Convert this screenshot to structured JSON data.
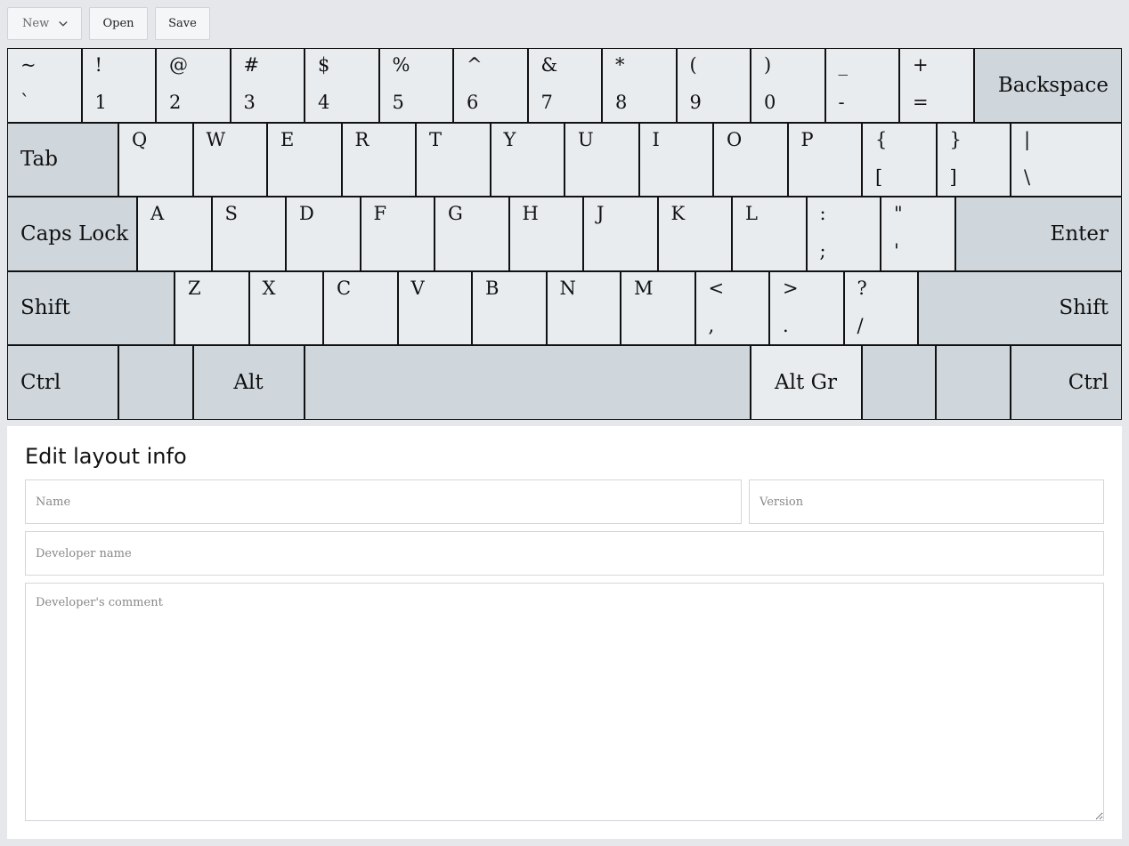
{
  "toolbar": {
    "new_label": "New",
    "open_label": "Open",
    "save_label": "Save"
  },
  "keyboard": {
    "row1": [
      {
        "up": "~",
        "down": "`"
      },
      {
        "up": "!",
        "down": "1"
      },
      {
        "up": "@",
        "down": "2"
      },
      {
        "up": "#",
        "down": "3"
      },
      {
        "up": "$",
        "down": "4"
      },
      {
        "up": "%",
        "down": "5"
      },
      {
        "up": "^",
        "down": "6"
      },
      {
        "up": "&",
        "down": "7"
      },
      {
        "up": "*",
        "down": "8"
      },
      {
        "up": "(",
        "down": "9"
      },
      {
        "up": ")",
        "down": "0"
      },
      {
        "up": "_",
        "down": "-"
      },
      {
        "up": "+",
        "down": "="
      }
    ],
    "backspace": "Backspace",
    "tab": "Tab",
    "row2": [
      {
        "up": "Q"
      },
      {
        "up": "W"
      },
      {
        "up": "E"
      },
      {
        "up": "R"
      },
      {
        "up": "T"
      },
      {
        "up": "Y"
      },
      {
        "up": "U"
      },
      {
        "up": "I"
      },
      {
        "up": "O"
      },
      {
        "up": "P"
      },
      {
        "up": "{",
        "down": "["
      },
      {
        "up": "}",
        "down": "]"
      },
      {
        "up": "|",
        "down": "\\"
      }
    ],
    "caps": "Caps Lock",
    "row3": [
      {
        "up": "A"
      },
      {
        "up": "S"
      },
      {
        "up": "D"
      },
      {
        "up": "F"
      },
      {
        "up": "G"
      },
      {
        "up": "H"
      },
      {
        "up": "J"
      },
      {
        "up": "K"
      },
      {
        "up": "L"
      },
      {
        "up": ":",
        "down": ";"
      },
      {
        "up": "\"",
        "down": "'"
      }
    ],
    "enter": "Enter",
    "shift_left": "Shift",
    "row4": [
      {
        "up": "Z"
      },
      {
        "up": "X"
      },
      {
        "up": "C"
      },
      {
        "up": "V"
      },
      {
        "up": "B"
      },
      {
        "up": "N"
      },
      {
        "up": "M"
      },
      {
        "up": "<",
        "down": ","
      },
      {
        "up": ">",
        "down": "."
      },
      {
        "up": "?",
        "down": "/"
      }
    ],
    "shift_right": "Shift",
    "ctrl_left": "Ctrl",
    "alt": "Alt",
    "altgr": "Alt Gr",
    "ctrl_right": "Ctrl"
  },
  "panel": {
    "title": "Edit layout info",
    "name_placeholder": "Name",
    "version_placeholder": "Version",
    "developer_placeholder": "Developer name",
    "comment_placeholder": "Developer's comment"
  }
}
